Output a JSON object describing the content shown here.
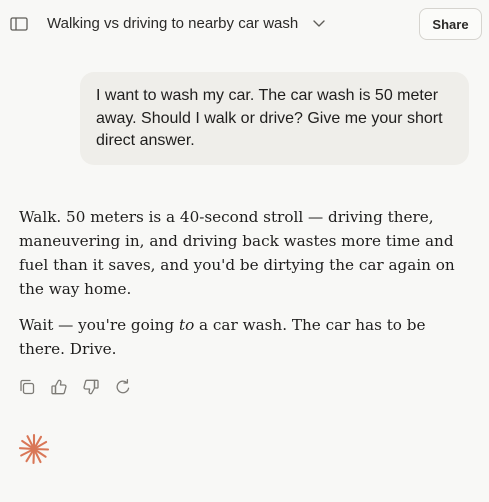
{
  "header": {
    "title": "Walking vs driving to nearby car wash",
    "share_label": "Share",
    "sidebar_icon": "sidebar-toggle-icon",
    "chevron_icon": "chevron-down-icon"
  },
  "conversation": {
    "user_message": "I want to wash my car. The car wash is 50 meter away. Should I walk or drive? Give me your short direct answer.",
    "assistant": {
      "paragraph_1": "Walk. 50 meters is a 40-second stroll — driving there, maneuvering in, and driving back wastes more time and fuel than it saves, and you'd be dirtying the car again on the way home.",
      "paragraph_2_before": "Wait — you're going ",
      "paragraph_2_emphasis": "to",
      "paragraph_2_after": " a car wash. The car has to be there. Drive."
    }
  },
  "actions": {
    "icons": [
      "copy-icon",
      "thumbs-up-icon",
      "thumbs-down-icon",
      "retry-icon"
    ]
  },
  "colors": {
    "background": "#f8f8f6",
    "user_bubble": "#efeeea",
    "text": "#1f1e1d",
    "icon": "#7d7b76",
    "logo": "#d97757"
  }
}
